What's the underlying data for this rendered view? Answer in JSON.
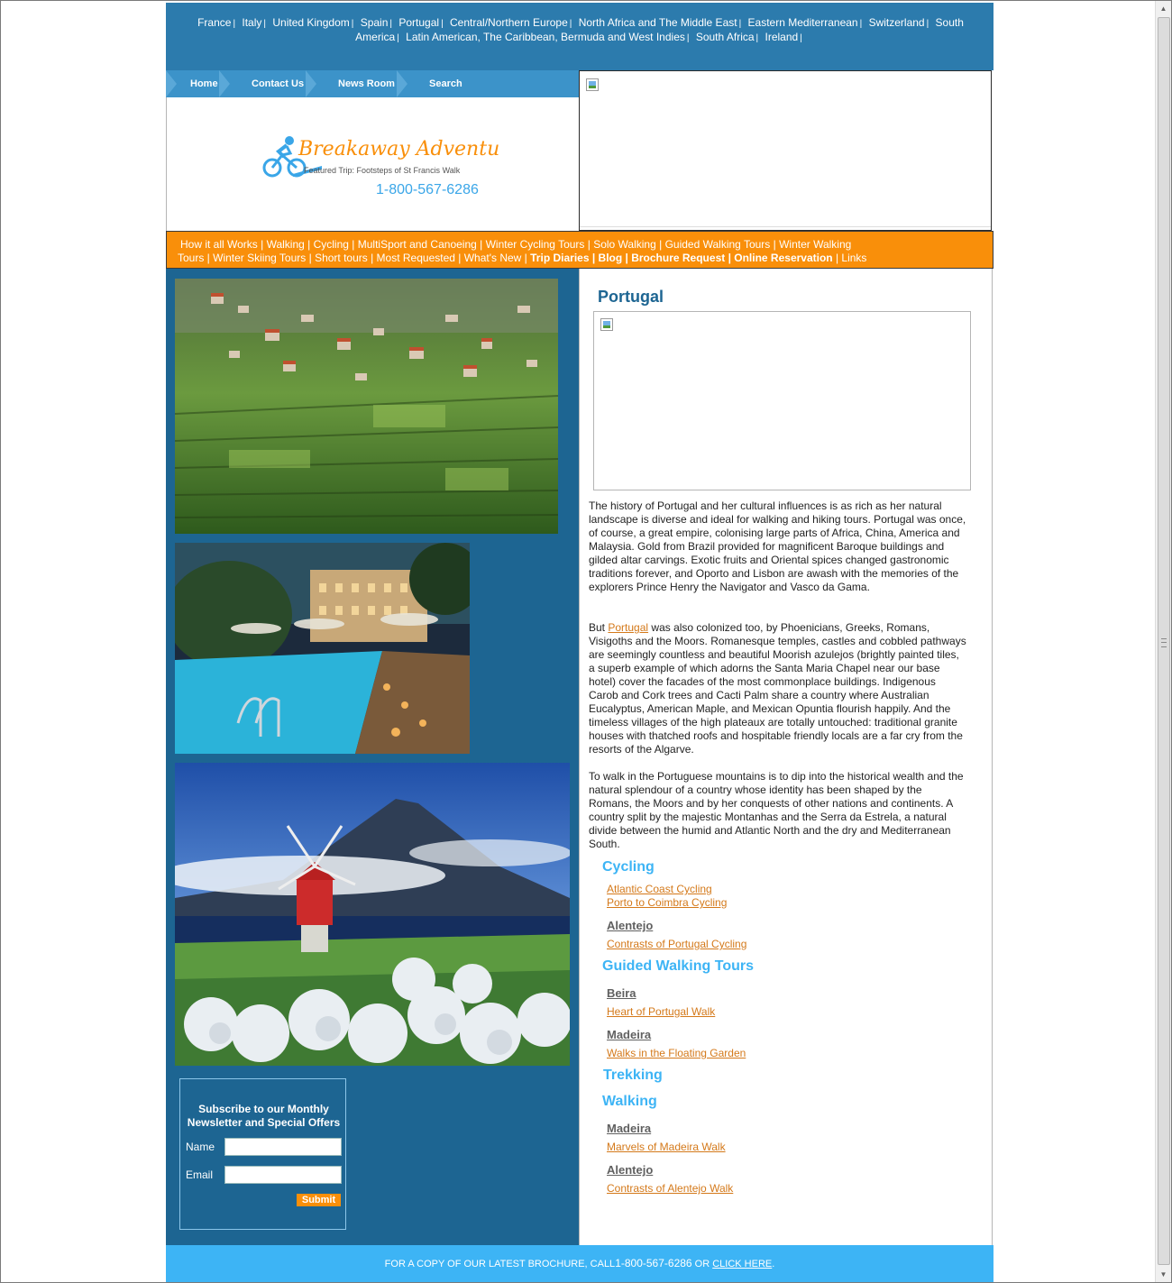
{
  "countries": [
    "France",
    "Italy",
    "United Kingdom",
    "Spain",
    "Portugal",
    "Central/Northern Europe",
    "North Africa and The Middle East",
    "Eastern Mediterranean",
    "Switzerland",
    "South America",
    "Latin American, The Caribbean, Bermuda and West Indies",
    "South Africa",
    "Ireland"
  ],
  "nav": {
    "home": "Home",
    "contact": "Contact Us",
    "news": "News Room",
    "search": "Search"
  },
  "logo": {
    "brand": "Breakaway Adventures",
    "featured": "Featured Trip: Footsteps of St Francis Walk",
    "phone": "1-800-567-6286"
  },
  "menu": {
    "line1": "How it all Works | Walking | Cycling | MultiSport and Canoeing | Winter Cycling Tours | Solo Walking | Guided Walking Tours | Winter Walking",
    "line2_plain": "Tours | Winter Skiing Tours | Short tours | Most Requested | What's New |",
    "line2_bold": "Trip Diaries | Blog | Brochure Request | Online Reservation",
    "line2_tail": "| Links"
  },
  "newsletter": {
    "title": "Subscribe to our Monthly Newsletter and Special Offers",
    "name_label": "Name",
    "email_label": "Email",
    "submit": "Submit",
    "name_value": "",
    "email_value": ""
  },
  "content": {
    "title": "Portugal",
    "p1": "The history of Portugal and her cultural influences is as rich as her natural landscape is diverse and ideal for walking and hiking tours. Portugal was once, of course, a great empire, colonising large parts of Africa, China, America and Malaysia. Gold from Brazil provided for magnificent Baroque buildings and gilded altar carvings. Exotic fruits and Oriental spices changed gastronomic traditions forever, and Oporto and Lisbon are awash with the memories of the explorers Prince Henry the Navigator and Vasco da Gama.",
    "p2_pre": "But",
    "p2_link": "Portugal",
    "p2_post": "was also colonized too, by Phoenicians, Greeks, Romans, Visigoths and the Moors. Romanesque temples, castles and cobbled pathways are seemingly countless and beautiful Moorish azulejos (brightly painted tiles, a superb example of which adorns the Santa Maria Chapel near our base hotel) cover the facades of the most commonplace buildings. Indigenous Carob and Cork trees and Cacti Palm share a country where Australian Eucalyptus, American Maple, and Mexican Opuntia flourish happily. And the timeless villages of the high plateaux are totally untouched: traditional granite houses with thatched roofs and hospitable friendly locals are a far cry from the resorts of the Algarve.",
    "p3": "To walk in the Portuguese mountains is to dip into the historical wealth and the natural splendour of a country whose identity has been shaped by the Romans, the Moors and by her conquests of other nations and continents. A country split by the majestic Montanhas and the Serra da Estrela, a natural divide between the humid and Atlantic North and the dry and Mediterranean South."
  },
  "tours": {
    "cycling": {
      "heading": "Cycling",
      "links": [
        "Atlantic Coast Cycling",
        "Porto to Coimbra Cycling"
      ],
      "region": "Alentejo",
      "region_link": "Contrasts of Portugal Cycling"
    },
    "guided": {
      "heading": "Guided Walking Tours",
      "region1": "Beira",
      "region1_link": "Heart of Portugal Walk",
      "region2": "Madeira",
      "region2_link": "Walks in the Floating Garden"
    },
    "trekking": {
      "heading": "Trekking"
    },
    "walking": {
      "heading": "Walking",
      "region1": "Madeira",
      "region1_link": "Marvels of Madeira Walk",
      "region2": "Alentejo",
      "region2_link": "Contrasts of Alentejo Walk"
    }
  },
  "footer": {
    "pre": "FOR A COPY OF OUR LATEST BROCHURE, CALL",
    "phone": "1-800-567-6286",
    "mid": "OR",
    "link": "CLICK HERE",
    "post": "."
  },
  "icons": [
    "broken-image-icon",
    "bicycle-logo-icon",
    "chevron-up-icon",
    "chevron-down-icon"
  ],
  "colors": {
    "blue_dark": "#1d6592",
    "blue_top": "#2c7bad",
    "orange": "#f98f0a",
    "footer_blue": "#3db4f5",
    "link_orange": "#d4791a"
  }
}
